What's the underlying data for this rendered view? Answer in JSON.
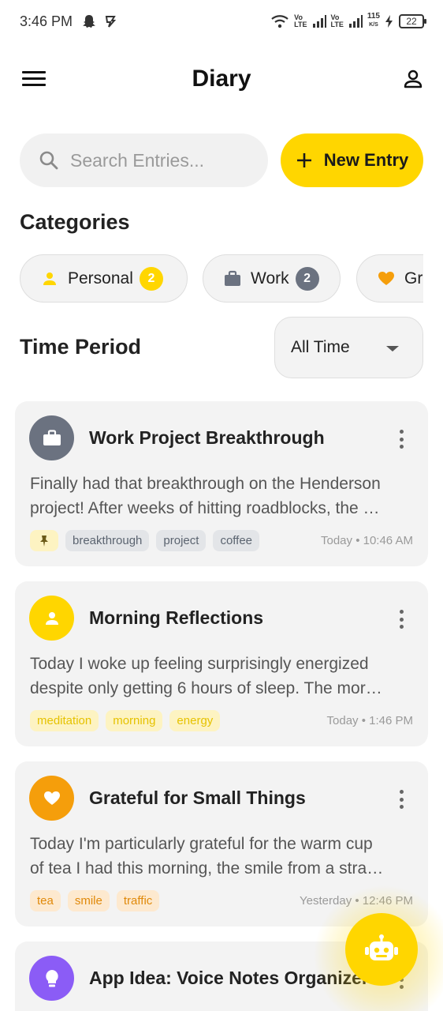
{
  "status_bar": {
    "time": "3:46 PM",
    "net_speed_top": "115",
    "net_speed_unit": "K/S",
    "battery": "22",
    "left_icons": [
      "snapchat-icon",
      "notification-icon"
    ],
    "right_icons": [
      "wifi-icon",
      "volte-icon",
      "signal-icon",
      "volte-icon",
      "signal-icon",
      "charging-icon"
    ]
  },
  "app_bar": {
    "title": "Diary",
    "menu_icon": "hamburger-menu-icon",
    "profile_icon": "person-icon"
  },
  "search": {
    "placeholder": "Search Entries..."
  },
  "new_entry": {
    "label": "New Entry"
  },
  "categories": {
    "title": "Categories",
    "items": [
      {
        "label": "Personal",
        "count": "2",
        "icon": "person-icon",
        "color": "#ffd600"
      },
      {
        "label": "Work",
        "count": "2",
        "icon": "briefcase-icon",
        "color": "#6b7280"
      },
      {
        "label": "Gratitude",
        "count": "",
        "icon": "heart-icon",
        "color": "#f59e0b"
      }
    ]
  },
  "time_period": {
    "title": "Time Period",
    "selected": "All Time"
  },
  "entries": [
    {
      "title": "Work Project Breakthrough",
      "line1": "Finally had that breakthrough on the Henderson",
      "line2": "project! After weeks of hitting roadblocks, the …",
      "pinned": true,
      "tags": [
        "breakthrough",
        "project",
        "coffee"
      ],
      "time": "Today • 10:46 AM",
      "icon": "briefcase-icon",
      "color": "#6b7280"
    },
    {
      "title": "Morning Reflections",
      "line1": "Today I woke up feeling surprisingly energized",
      "line2": "despite only getting 6 hours of sleep. The mor…",
      "pinned": false,
      "tags": [
        "meditation",
        "morning",
        "energy"
      ],
      "time": "Today • 1:46 PM",
      "icon": "person-icon",
      "color": "#ffd600"
    },
    {
      "title": "Grateful for Small Things",
      "line1": "Today I'm particularly grateful for the warm cup",
      "line2": "of tea I had this morning, the smile from a stra…",
      "pinned": false,
      "tags": [
        "tea",
        "smile",
        "traffic"
      ],
      "time": "Yesterday • 12:46 PM",
      "icon": "heart-icon",
      "color": "#f59e0b"
    },
    {
      "title": "App Idea: Voice Notes Organizer",
      "icon": "lightbulb-icon",
      "color": "#8b5cf6"
    }
  ],
  "fab": {
    "icon": "robot-icon"
  }
}
